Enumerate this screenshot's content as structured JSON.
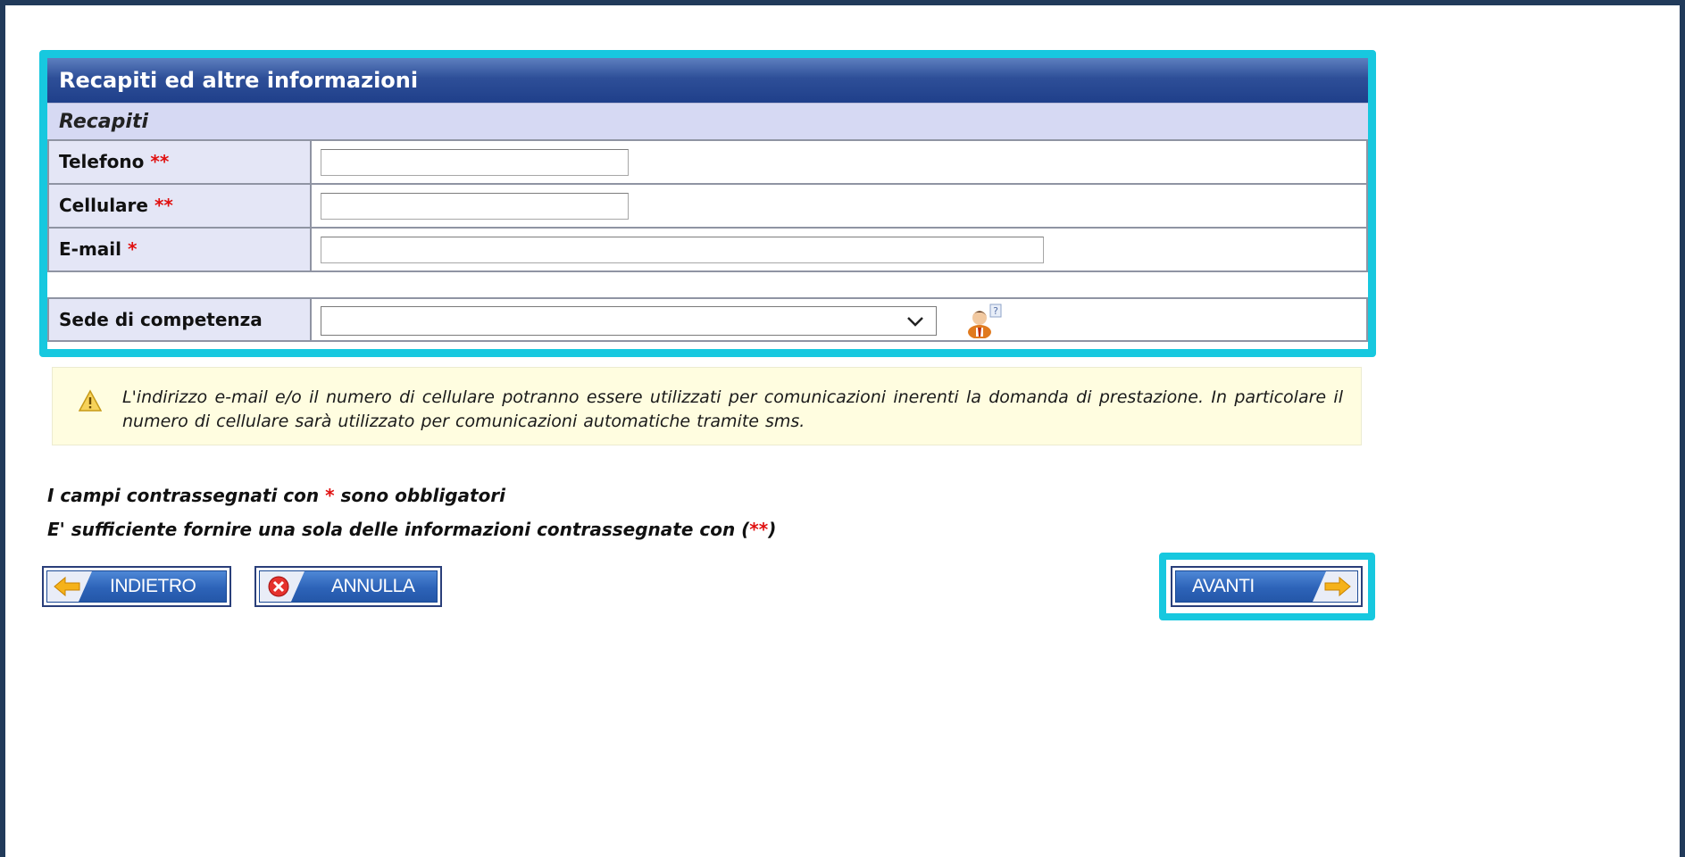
{
  "panel": {
    "title": "Recapiti ed altre informazioni",
    "section": "Recapiti",
    "rows": [
      {
        "label": "Telefono",
        "required": "**",
        "value": "",
        "placeholder": ""
      },
      {
        "label": "Cellulare",
        "required": "**",
        "value": "",
        "placeholder": ""
      },
      {
        "label": "E-mail",
        "required": "*",
        "value": "",
        "placeholder": ""
      }
    ],
    "sede": {
      "label": "Sede di competenza",
      "selected": ""
    }
  },
  "warning": {
    "text": "L'indirizzo e-mail e/o il numero di cellulare potranno essere utilizzati per comunicazioni inerenti la domanda di prestazione. In particolare il numero di cellulare sarà utilizzato per comunicazioni automatiche tramite sms."
  },
  "notes": {
    "required_prefix": "I campi contrassegnati con ",
    "required_star": "*",
    "required_suffix": " sono obbligatori",
    "either_prefix": "E' sufficiente fornire una sola delle informazioni contrassegnate con (",
    "either_star": "**",
    "either_suffix": ")"
  },
  "buttons": {
    "back": "INDIETRO",
    "cancel": "ANNULLA",
    "next": "AVANTI"
  },
  "colors": {
    "highlight": "#17c8df",
    "header_blue": "#2e4f98",
    "required_red": "#e01010"
  },
  "icons": [
    "help-user-icon",
    "warning-icon",
    "arrow-left-icon",
    "cancel-icon",
    "arrow-right-icon",
    "chevron-down-icon"
  ]
}
